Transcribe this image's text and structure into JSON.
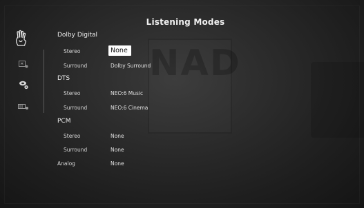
{
  "screen": {
    "title": "Listening Modes",
    "watermark_text": "NAD"
  },
  "sidebar": {
    "icons": [
      {
        "name": "hand-gesture-icon"
      },
      {
        "name": "display-settings-icon"
      },
      {
        "name": "speaker-settings-icon"
      },
      {
        "name": "audio-input-icon"
      }
    ]
  },
  "sections": {
    "dolby": {
      "label": "Dolby Digital",
      "stereo_label": "Stereo",
      "stereo_value": "None",
      "surround_label": "Surround",
      "surround_value": "Dolby Surround"
    },
    "dts": {
      "label": "DTS",
      "stereo_label": "Stereo",
      "stereo_value": "NEO:6 Music",
      "surround_label": "Surround",
      "surround_value": "NEO:6 Cinema"
    },
    "pcm": {
      "label": "PCM",
      "stereo_label": "Stereo",
      "stereo_value": "None",
      "surround_label": "Surround",
      "surround_value": "None"
    },
    "analog": {
      "label": "Analog",
      "value": "None"
    }
  },
  "colors": {
    "background": "#2a2a2a",
    "text": "#e6e6e6",
    "highlight_bg": "#ffffff",
    "highlight_text": "#111111"
  }
}
